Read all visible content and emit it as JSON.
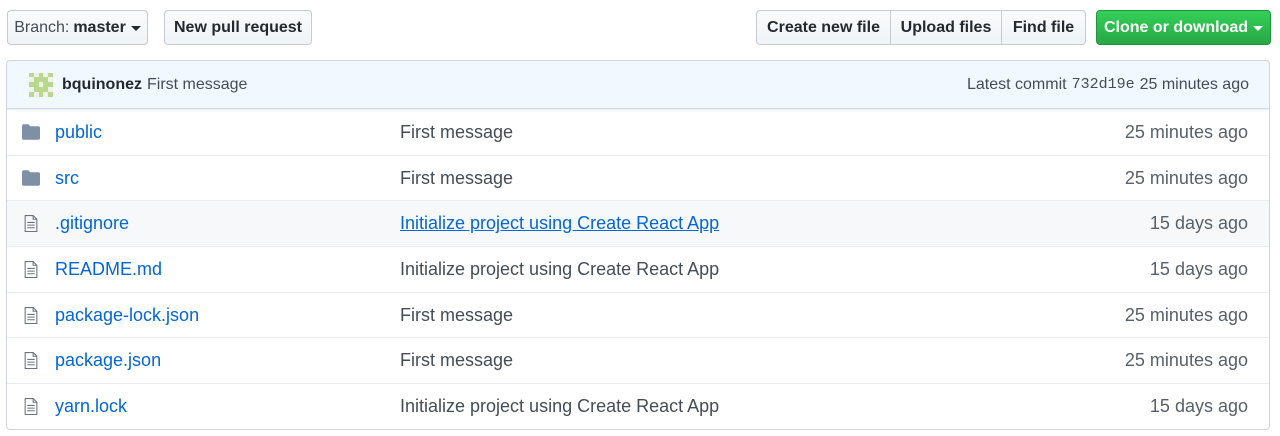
{
  "toolbar": {
    "branch_prefix": "Branch:",
    "branch_name": "master",
    "new_pr_label": "New pull request",
    "create_file_label": "Create new file",
    "upload_files_label": "Upload files",
    "find_file_label": "Find file",
    "clone_label": "Clone or download"
  },
  "commit": {
    "author": "bquinonez",
    "message": "First message",
    "latest_label": "Latest commit",
    "sha": "732d19e",
    "age": "25 minutes ago"
  },
  "files": [
    {
      "name": "public",
      "type": "folder",
      "message": "First message",
      "age": "25 minutes ago"
    },
    {
      "name": "src",
      "type": "folder",
      "message": "First message",
      "age": "25 minutes ago"
    },
    {
      "name": ".gitignore",
      "type": "file",
      "message": "Initialize project using Create React App",
      "age": "15 days ago"
    },
    {
      "name": "README.md",
      "type": "file",
      "message": "Initialize project using Create React App",
      "age": "15 days ago"
    },
    {
      "name": "package-lock.json",
      "type": "file",
      "message": "First message",
      "age": "25 minutes ago"
    },
    {
      "name": "package.json",
      "type": "file",
      "message": "First message",
      "age": "25 minutes ago"
    },
    {
      "name": "yarn.lock",
      "type": "file",
      "message": "Initialize project using Create React App",
      "age": "15 days ago"
    }
  ],
  "colors": {
    "link": "#0366d6",
    "primary_button": "#28a745",
    "commit_bar": "#f1f8ff",
    "icon": "#6a737d"
  }
}
